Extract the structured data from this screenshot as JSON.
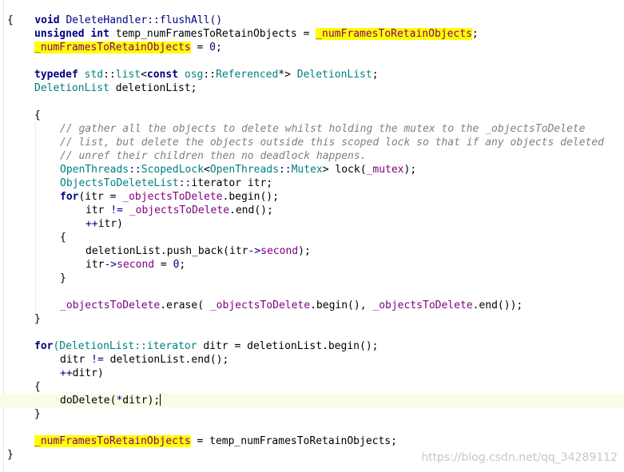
{
  "code": {
    "l1": {
      "ret": "void",
      "sig": "DeleteHandler::flushAll()"
    },
    "l2": "{",
    "l3": {
      "kw1": "unsigned",
      "kw2": "int",
      "var": "temp_numFramesToRetainObjects",
      "eq": "=",
      "member": "_numFramesToRetainObjects",
      "end": ";"
    },
    "l4": {
      "member": "_numFramesToRetainObjects",
      "rest": " = ",
      "num": "0",
      "end": ";"
    },
    "l6": {
      "kw": "typedef",
      "ns1": "std",
      "sep": "::",
      "ty": "list",
      "lt": "<",
      "kw2": "const",
      "ns2": "osg",
      "ty2": "Referenced",
      "ptr": "*>",
      "name": "DeletionList",
      "end": ";"
    },
    "l7": {
      "ty": "DeletionList",
      "rest": " deletionList;"
    },
    "l9": "{",
    "c1": "// gather all the objects to delete whilst holding the mutex to the _objectsToDelete",
    "c2": "// list, but delete the objects outside this scoped lock so that if any objects deleted",
    "c3": "// unref their children then no deadlock happens.",
    "l13": {
      "ns": "OpenThreads",
      "ty": "ScopedLock",
      "ns2": "OpenThreads",
      "ty2": "Mutex",
      "rest": "> lock(",
      "member": "_mutex",
      "end": ");"
    },
    "l14": {
      "ty": "ObjectsToDeleteList",
      "sep": "::",
      "rest": "iterator itr;"
    },
    "l15": {
      "kw": "for",
      "rest": "(itr = ",
      "member": "_objectsToDelete",
      "rest2": ".begin();"
    },
    "l16": {
      "pre": "itr ",
      "op": "!=",
      "mid": " ",
      "member": "_objectsToDelete",
      "rest": ".end();"
    },
    "l17": {
      "op": "++",
      "rest": "itr)"
    },
    "l18": "{",
    "l19": {
      "pre": "deletionList.push_back(itr",
      "op": "->",
      "member": "second",
      "end": ");"
    },
    "l20": {
      "pre": "itr",
      "op": "->",
      "member": "second",
      "eq": " = ",
      "num": "0",
      "end": ";"
    },
    "l21": "}",
    "l23": {
      "m1": "_objectsToDelete",
      "r1": ".erase( ",
      "m2": "_objectsToDelete",
      "r2": ".begin(), ",
      "m3": "_objectsToDelete",
      "r3": ".end());"
    },
    "l24": "}",
    "l26": {
      "kw": "for",
      "ty": "(DeletionList::iterator",
      "rest": " ditr = deletionList.begin();"
    },
    "l27": {
      "pre": "ditr ",
      "op": "!=",
      "rest": " deletionList.end();"
    },
    "l28": {
      "op": "++",
      "rest": "ditr)"
    },
    "l29": "{",
    "l30": {
      "pre": "doDelete(",
      "op": "*",
      "rest": "ditr);"
    },
    "l31": "}",
    "l33": {
      "member": "_numFramesToRetainObjects",
      "rest": " = temp_numFramesToRetainObjects;"
    },
    "l34": "}"
  },
  "watermark": "https://blog.csdn.net/qq_34289112"
}
